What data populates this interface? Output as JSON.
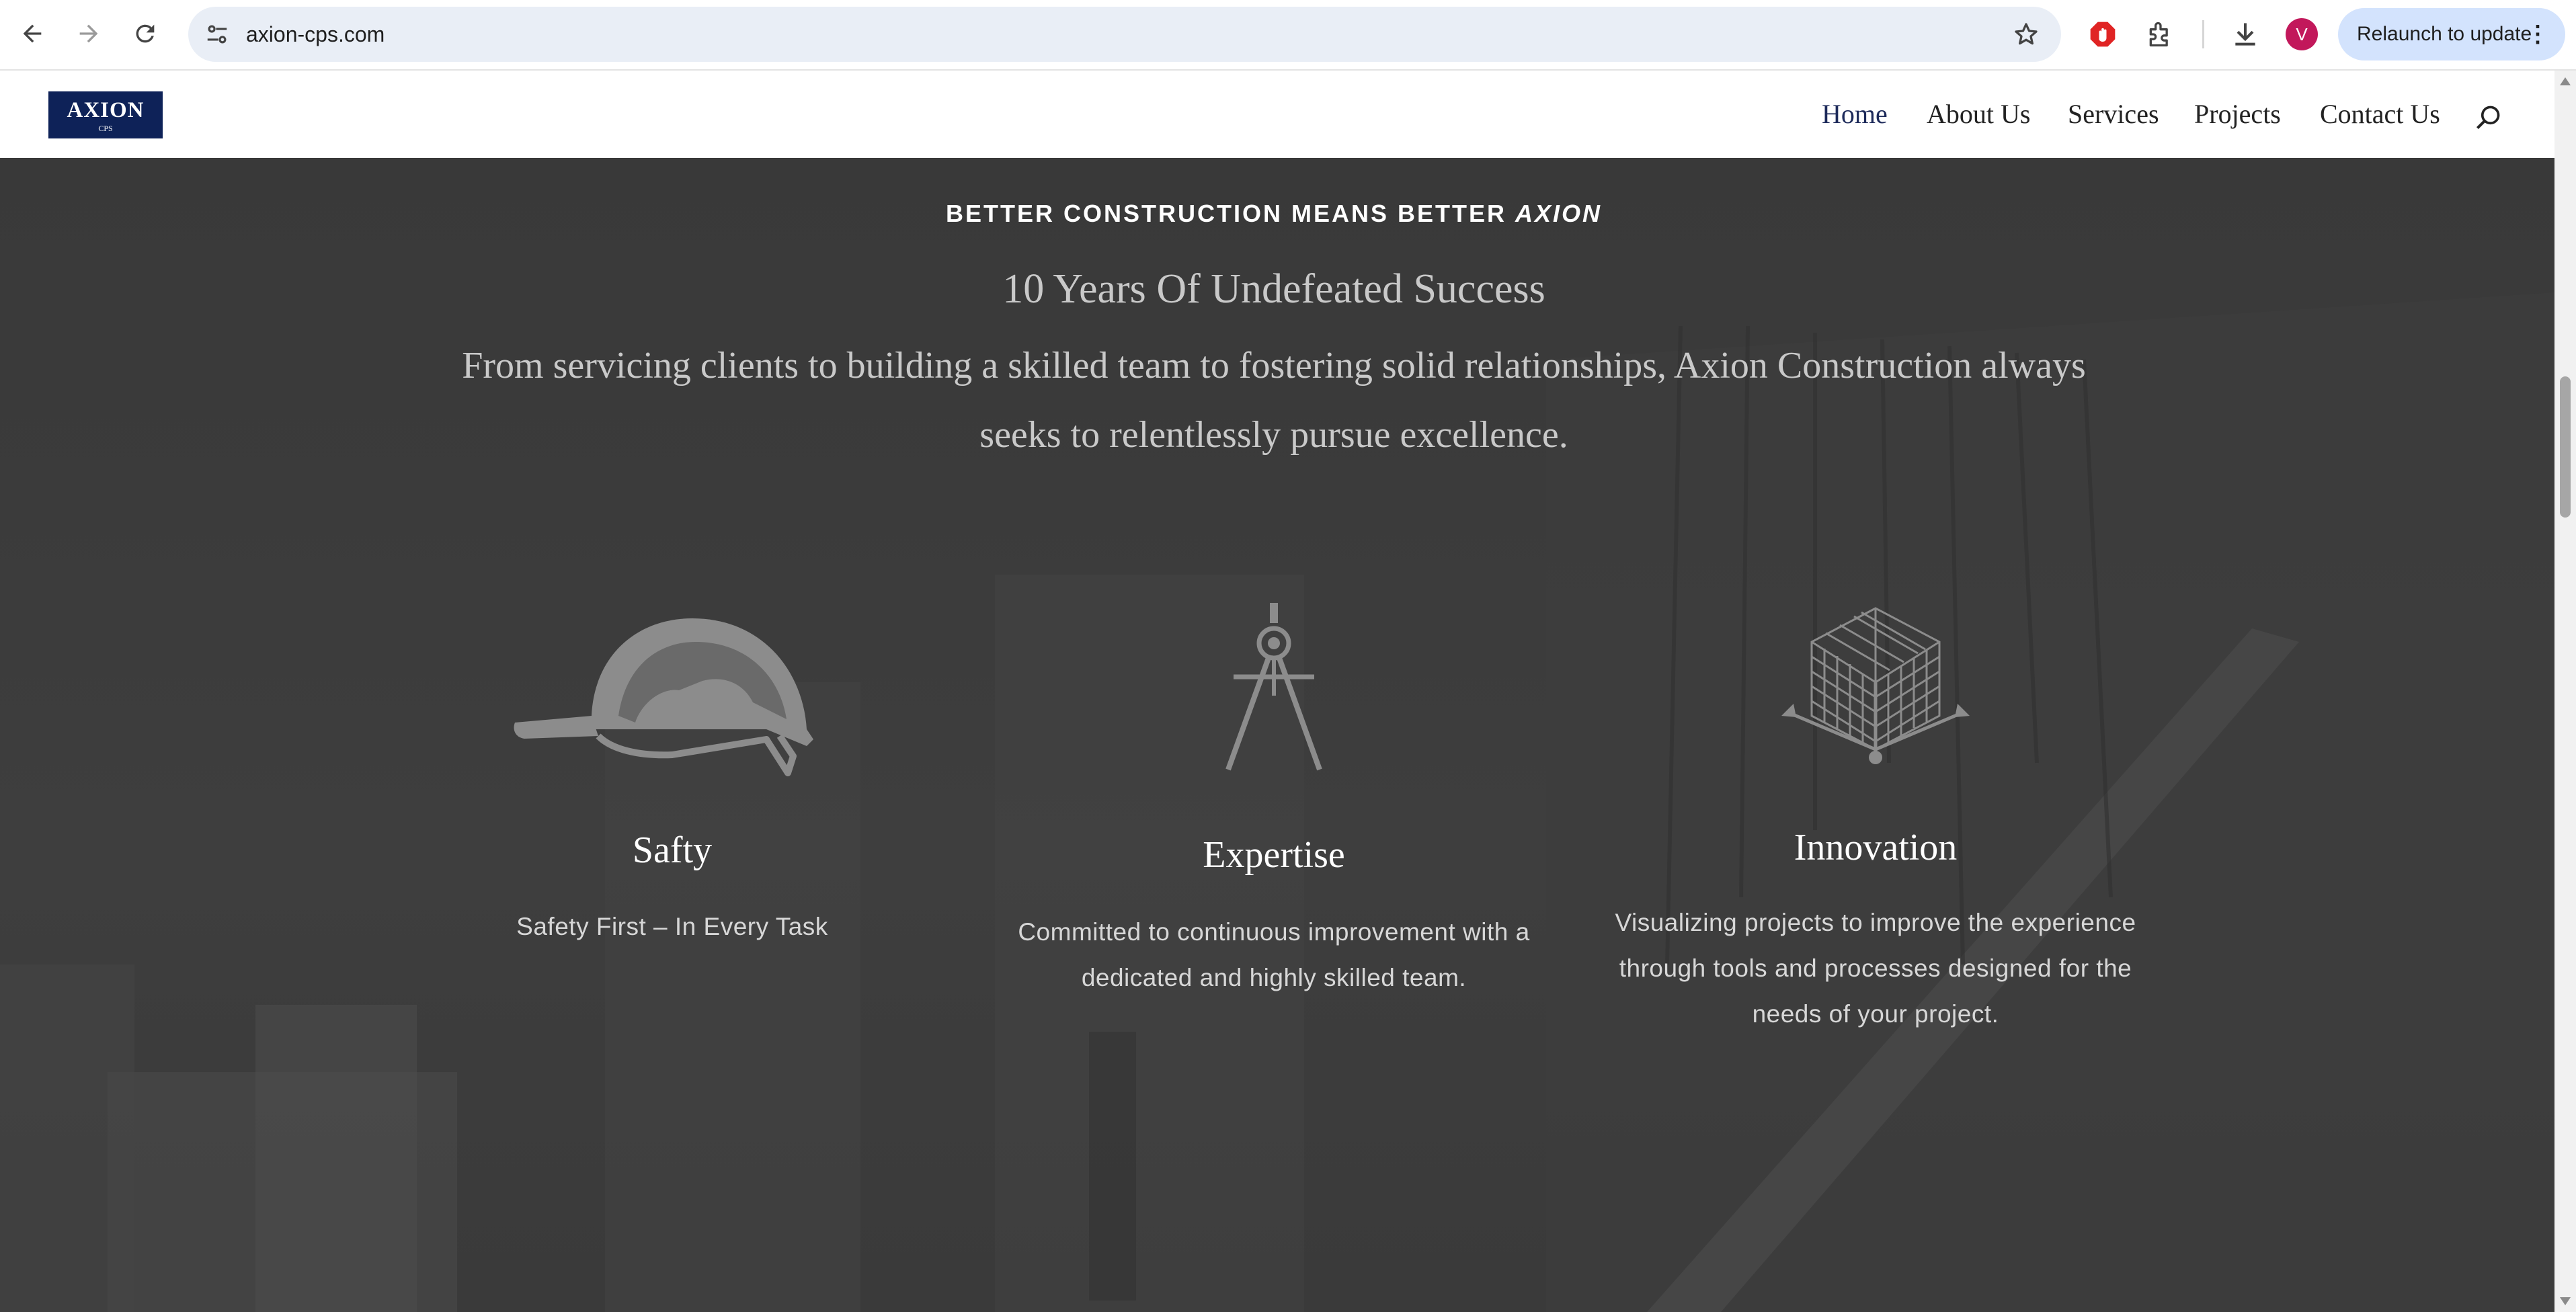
{
  "browser": {
    "url": "axion-cps.com",
    "relaunch_label": "Relaunch to update",
    "avatar_initial": "V",
    "icons": {
      "back": "arrow-left",
      "forward": "arrow-right",
      "reload": "reload",
      "site_info": "tune",
      "bookmark": "star-outline",
      "extension_adblock": "red-hand-stop",
      "extensions": "puzzle-piece",
      "downloads": "download-arrow",
      "menu": "vertical-dots"
    }
  },
  "site": {
    "logo": {
      "name": "AXION",
      "sub": "CPS",
      "background": "#0e2258"
    },
    "nav": {
      "items": [
        {
          "label": "Home",
          "active": true
        },
        {
          "label": "About Us",
          "active": false
        },
        {
          "label": "Services",
          "active": false
        },
        {
          "label": "Projects",
          "active": false
        },
        {
          "label": "Contact Us",
          "active": false
        }
      ],
      "search_icon": "search"
    }
  },
  "hero": {
    "tagline_prefix": "BETTER CONSTRUCTION MEANS BETTER ",
    "tagline_emphasis": "AXION",
    "subtitle": "10 Years Of Undefeated Success",
    "description": "From servicing clients to building a skilled team to fostering solid relationships, Axion Construction always seeks to relentlessly pursue excellence.",
    "features": [
      {
        "icon": "hard-hat-icon",
        "title": "Safty",
        "text": "Safety First – In Every Task"
      },
      {
        "icon": "drafting-compass-icon",
        "title": "Expertise",
        "text": "Committed to continuous improvement with a dedicated and highly skilled team."
      },
      {
        "icon": "3d-grid-cube-icon",
        "title": "Innovation",
        "text": "Visualizing projects to improve the experience through tools and processes designed for the needs of your project."
      }
    ]
  },
  "colors": {
    "hero_overlay": "#3a3a3a",
    "icon_gray": "#8c8c8c",
    "heading_white": "#ffffff",
    "body_text": "#d7d7d7",
    "nav_active": "#1d2a5a"
  }
}
